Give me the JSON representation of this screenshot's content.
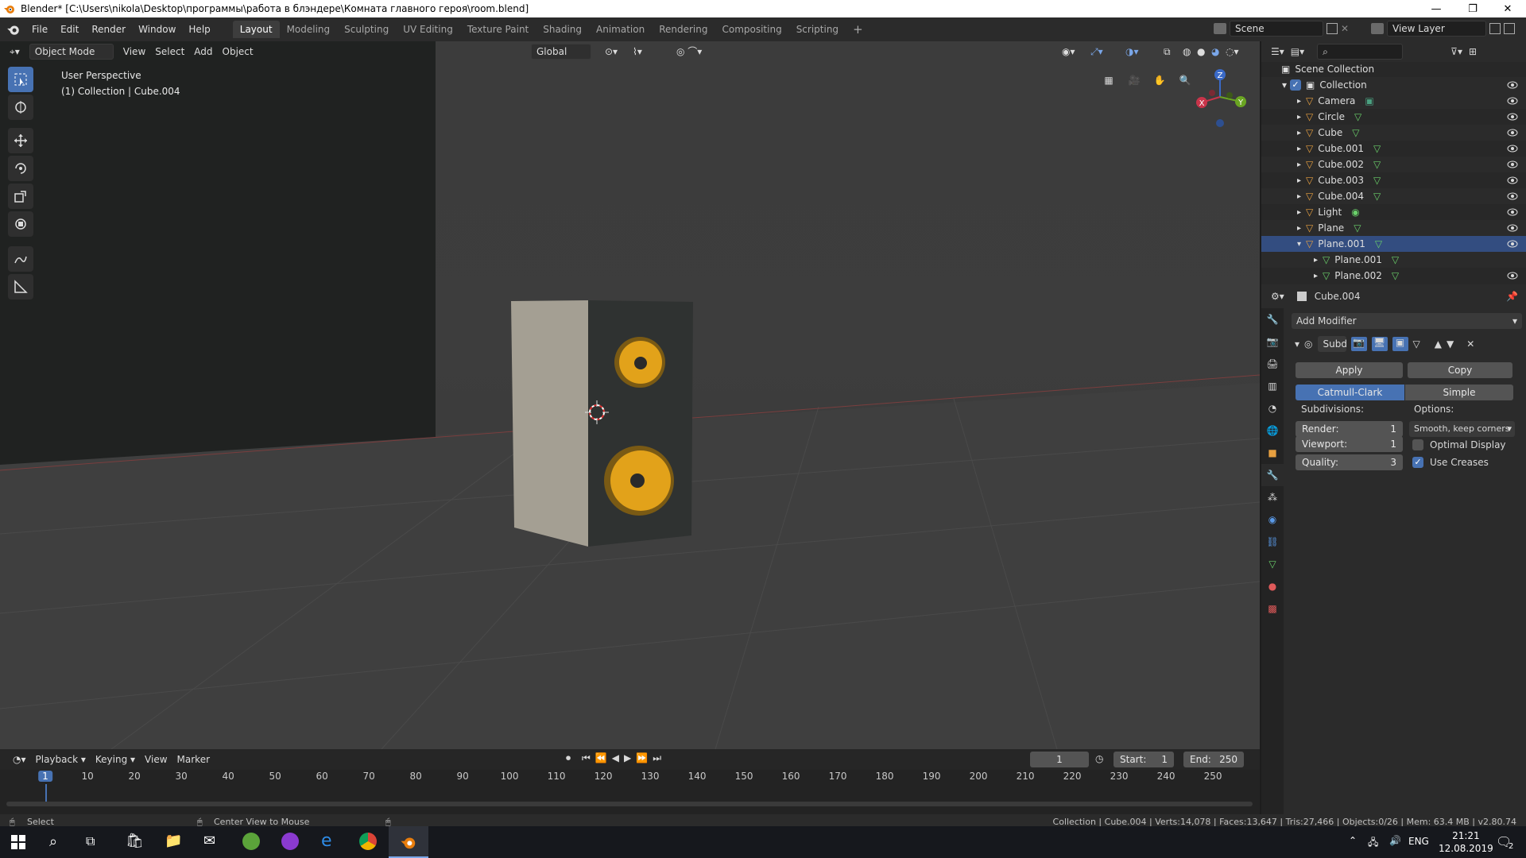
{
  "window": {
    "title": "Blender* [C:\\Users\\nikola\\Desktop\\программы\\работа в блэндере\\Комната главного героя\\room.blend]",
    "minimize": "—",
    "maximize": "❐",
    "close": "✕"
  },
  "menu": [
    "File",
    "Edit",
    "Render",
    "Window",
    "Help"
  ],
  "workspaces": [
    "Layout",
    "Modeling",
    "Sculpting",
    "UV Editing",
    "Texture Paint",
    "Shading",
    "Animation",
    "Rendering",
    "Compositing",
    "Scripting"
  ],
  "active_workspace": "Layout",
  "add_workspace": "+",
  "scene": "Scene",
  "view_layer": "View Layer",
  "viewport": {
    "mode": "Object Mode",
    "menus": [
      "View",
      "Select",
      "Add",
      "Object"
    ],
    "orientation": "Global",
    "overlay_line1": "User Perspective",
    "overlay_line2": "(1) Collection | Cube.004",
    "gizmo": {
      "x": "X",
      "y": "Y",
      "z": "Z"
    }
  },
  "outliner": {
    "root": "Scene Collection",
    "collection": "Collection",
    "items": [
      {
        "name": "Camera",
        "type": "camera"
      },
      {
        "name": "Circle",
        "type": "mesh"
      },
      {
        "name": "Cube",
        "type": "mesh"
      },
      {
        "name": "Cube.001",
        "type": "mesh"
      },
      {
        "name": "Cube.002",
        "type": "mesh"
      },
      {
        "name": "Cube.003",
        "type": "mesh"
      },
      {
        "name": "Cube.004",
        "type": "mesh"
      },
      {
        "name": "Light",
        "type": "light"
      },
      {
        "name": "Plane",
        "type": "mesh"
      },
      {
        "name": "Plane.001",
        "type": "mesh",
        "selected": true
      },
      {
        "name": "Plane.001",
        "type": "child"
      },
      {
        "name": "Plane.002",
        "type": "child"
      }
    ]
  },
  "properties": {
    "object": "Cube.004",
    "add_modifier": "Add Modifier",
    "modifier_name": "Subd",
    "apply": "Apply",
    "copy": "Copy",
    "catmull": "Catmull-Clark",
    "simple": "Simple",
    "subdivisions_label": "Subdivisions:",
    "options_label": "Options:",
    "render_label": "Render:",
    "render_val": "1",
    "viewport_label": "Viewport:",
    "viewport_val": "1",
    "quality_label": "Quality:",
    "quality_val": "3",
    "uv_smooth": "Smooth, keep corners",
    "optimal_display": "Optimal Display",
    "use_creases": "Use Creases"
  },
  "timeline": {
    "menus": [
      "Playback",
      "Keying",
      "View",
      "Marker"
    ],
    "current_frame": "1",
    "start_label": "Start:",
    "start": "1",
    "end_label": "End:",
    "end": "250",
    "ticks": [
      "1",
      "10",
      "20",
      "30",
      "40",
      "50",
      "60",
      "70",
      "80",
      "90",
      "100",
      "110",
      "120",
      "130",
      "140",
      "150",
      "160",
      "170",
      "180",
      "190",
      "200",
      "210",
      "220",
      "230",
      "240",
      "250"
    ]
  },
  "status": {
    "left": "Select",
    "middle": "Center View to Mouse",
    "right": "Collection | Cube.004 | Verts:14,078 | Faces:13,647 | Tris:27,466 | Objects:0/26 | Mem: 63.4 MB | v2.80.74"
  },
  "taskbar": {
    "lang": "ENG",
    "time": "21:21",
    "date": "12.08.2019",
    "notif": "2"
  },
  "colors": {
    "accent": "#4772b3",
    "selected_row": "#334d80",
    "speaker_cone": "#e2a21a",
    "active_tool": "#4772b3"
  }
}
